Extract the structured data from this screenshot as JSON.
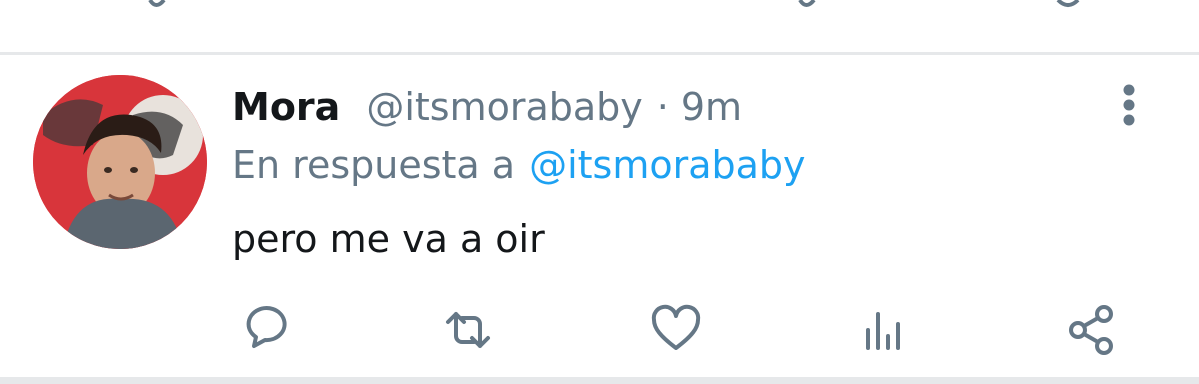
{
  "tweet": {
    "display_name": "Mora",
    "handle": "@itsmorababy",
    "separator": "·",
    "time": "9m",
    "reply_prefix": "En respuesta a",
    "reply_handle": "@itsmorababy",
    "text": "pero me va a oir"
  },
  "icons": {
    "more": "more-vertical-icon",
    "reply": "reply-icon",
    "retweet": "retweet-icon",
    "like": "heart-icon",
    "analytics": "analytics-icon",
    "share": "share-icon"
  },
  "colors": {
    "primary_text": "#14171a",
    "secondary_text": "#657786",
    "link": "#1da1f2",
    "icon": "#657786",
    "divider": "#e6e8ea"
  }
}
